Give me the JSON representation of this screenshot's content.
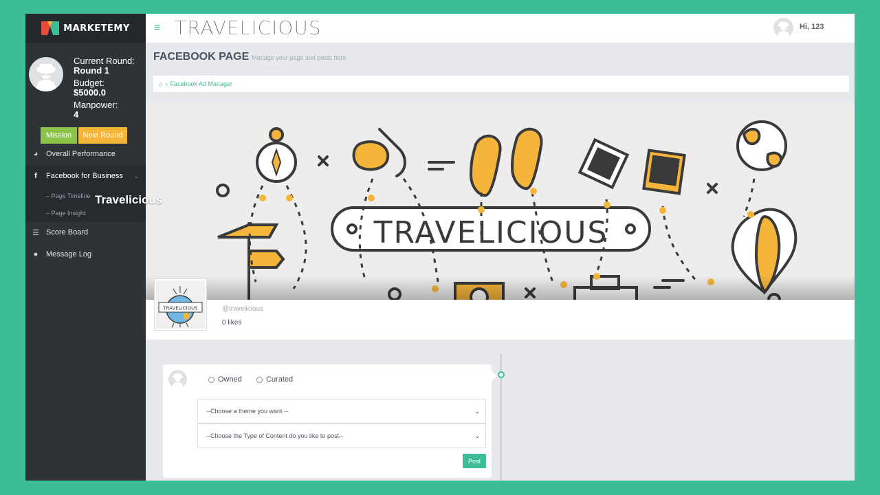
{
  "brand": {
    "name": "MARKETEMY"
  },
  "sidebar": {
    "current_round_label": "Current Round:",
    "current_round_value": "Round 1",
    "budget_label": "Budget:",
    "budget_value": "$5000.0",
    "manpower_label": "Manpower:",
    "manpower_value": "4",
    "mission_label": "Mission",
    "next_round_label": "Next Round",
    "nav": [
      {
        "label": "Overall Performance",
        "icon": "dashboard-icon"
      },
      {
        "label": "Facebook for Business",
        "icon": "facebook-icon"
      },
      {
        "label": "Score Board",
        "icon": "list-icon"
      },
      {
        "label": "Message Log",
        "icon": "chat-icon"
      }
    ],
    "sub_items": [
      "Page Timeline",
      "Page Insight"
    ]
  },
  "header": {
    "logo_text": "TRAVELICIOUS",
    "greeting": "Hi, 123"
  },
  "page": {
    "title": "FACEBOOK PAGE",
    "subtitle": "Manage your page and posts here",
    "breadcrumb": "Facebook Ad Manager",
    "cover_banner_text": "TRAVELICIOUS",
    "name": "Travelicious",
    "handle": "@travelicious",
    "likes": "0 likes",
    "thumb_text": "TRAVELICIOUS"
  },
  "composer": {
    "radio_owned": "Owned",
    "radio_curated": "Curated",
    "theme_select": "--Choose a theme you want --",
    "content_select": "--Choose the Type of Content do you like to post--",
    "post_label": "Post"
  },
  "colors": {
    "accent": "#3cbc97",
    "yellow": "#f5b53a",
    "green": "#8bc34a",
    "sidebar": "#2e3338"
  }
}
